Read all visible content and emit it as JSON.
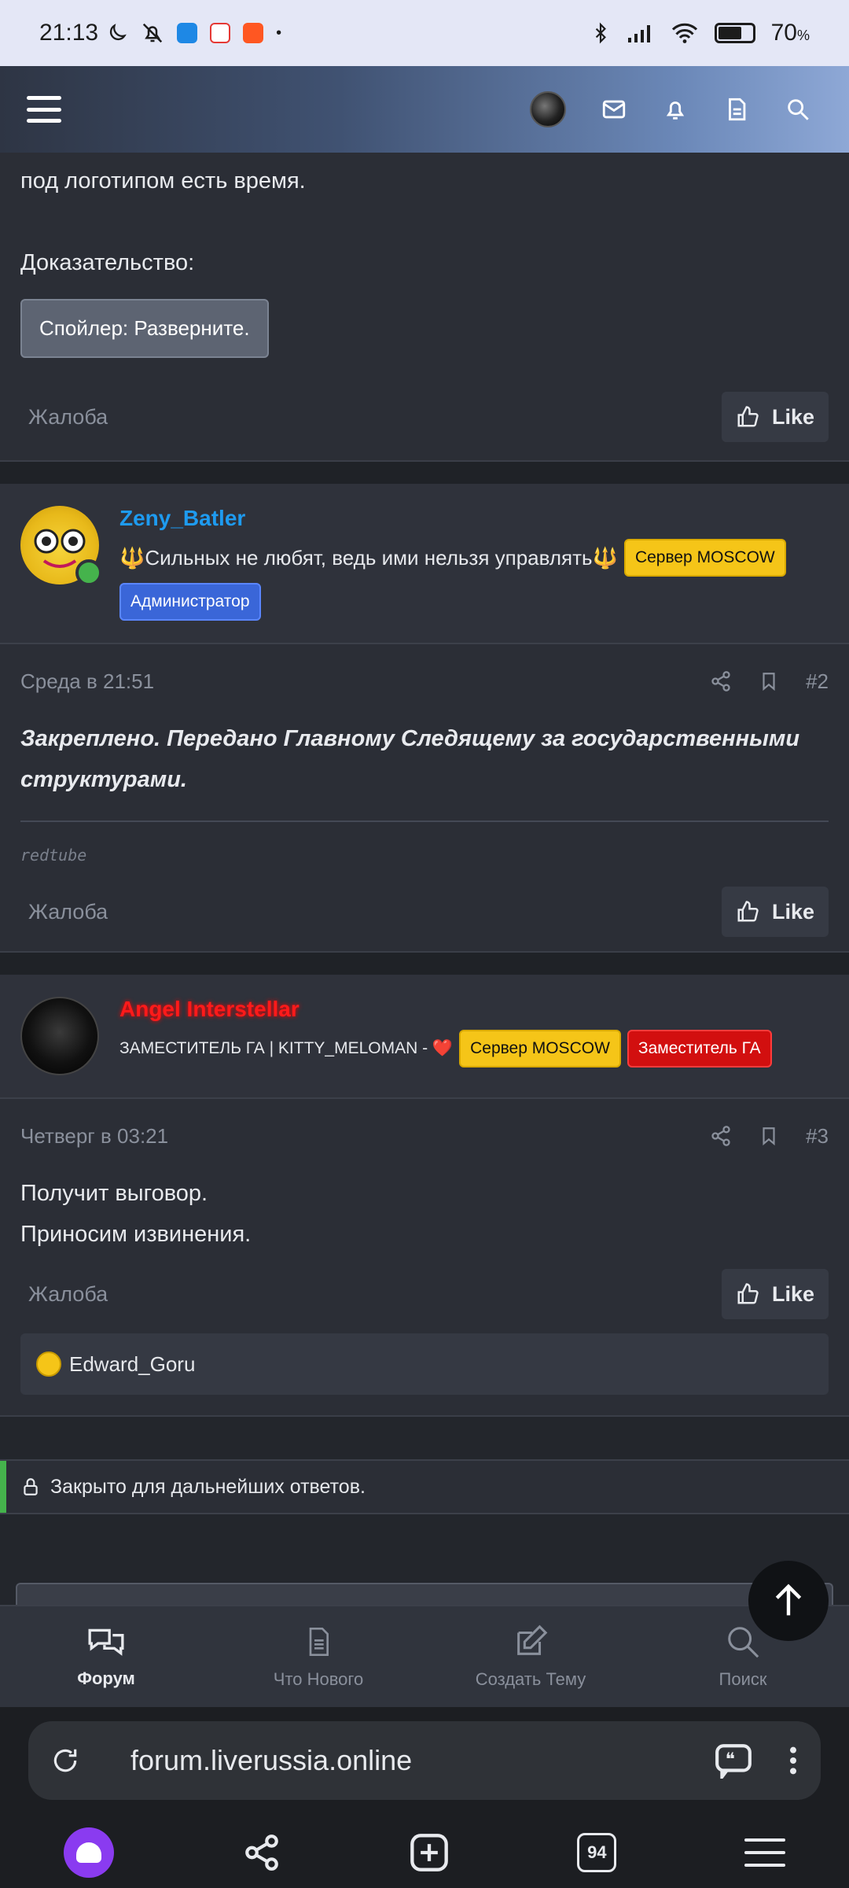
{
  "status": {
    "time": "21:13",
    "battery": "70",
    "battery_unit": "%",
    "battery_fraction": 0.7
  },
  "post1": {
    "line1": "под логотипом есть время.",
    "line2": "Доказательство:",
    "spoiler": "Спойлер: Разверните.",
    "report": "Жалоба",
    "like": "Like"
  },
  "post2": {
    "username": "Zeny_Batler",
    "username_color": "#1e9bf0",
    "title": "🔱Сильных не любят, ведь ими нельзя управлять🔱",
    "badge_server": "Сервер MOSCOW",
    "badge_role": "Администратор",
    "date": "Среда в 21:51",
    "number": "#2",
    "message": "Закреплено. Передано Главному Следящему за государственными структурами.",
    "signature": "redtube",
    "report": "Жалоба",
    "like": "Like"
  },
  "post3": {
    "username": "Angel Interstellar",
    "username_color": "#ff1a1a",
    "title": "ЗАМЕСТИТЕЛЬ ГА | KITTY_MELOMAN - ❤️",
    "badge_server": "Сервер MOSCOW",
    "badge_role": "Заместитель ГА",
    "date": "Четверг в 03:21",
    "number": "#3",
    "line1": "Получит выговор.",
    "line2": "Приносим извинения.",
    "report": "Жалоба",
    "like": "Like",
    "reaction_user": "Edward_Goru"
  },
  "closed_notice": "Закрыто для дальнейших ответов.",
  "tabs": [
    {
      "label": "Форум",
      "icon": "chat-bubbles-icon"
    },
    {
      "label": "Что Нового",
      "icon": "document-icon"
    },
    {
      "label": "Создать Тему",
      "icon": "edit-icon"
    },
    {
      "label": "Поиск",
      "icon": "search-icon"
    }
  ],
  "browser": {
    "url": "forum.liverussia.online",
    "tab_count": "94"
  }
}
